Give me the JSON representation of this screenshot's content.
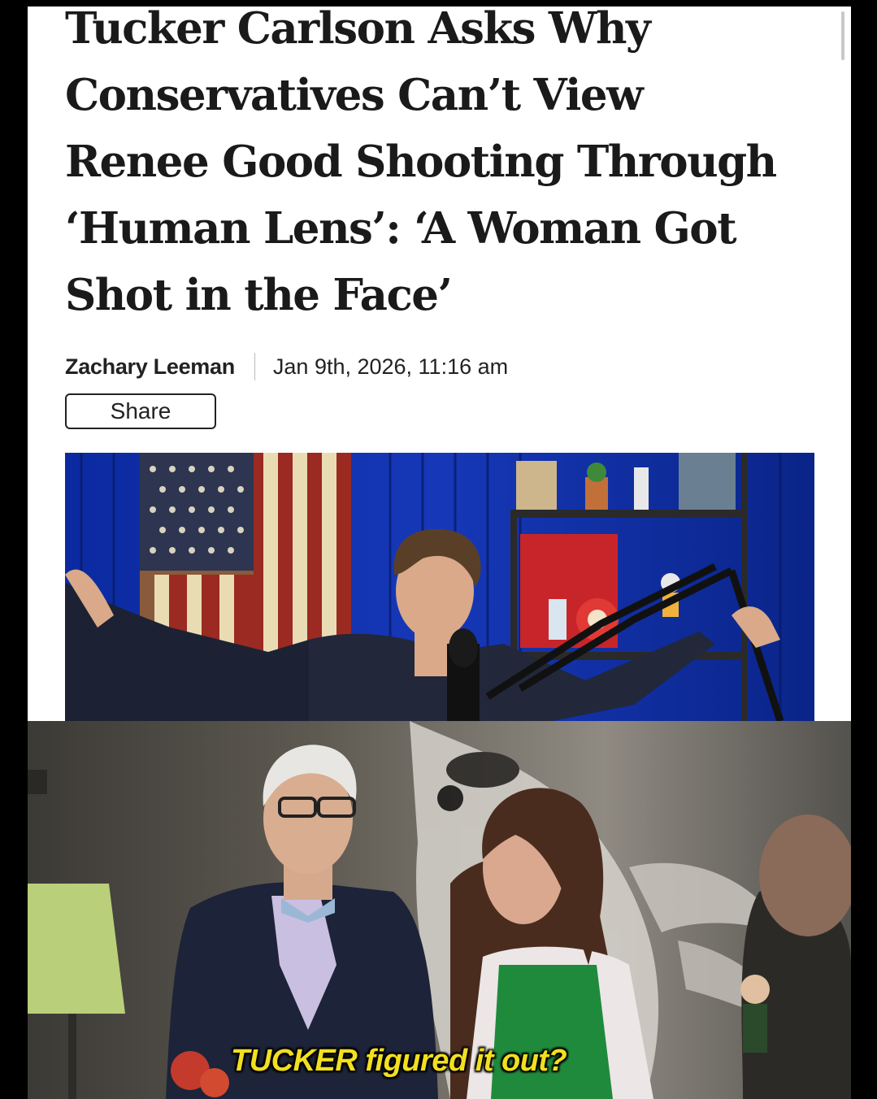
{
  "article": {
    "headline": "Tucker Carlson Asks Why Conservatives Can’t View Renee Good Shooting Through ‘Human Lens’: ‘A Woman Got Shot in the Face’",
    "author": "Zachary Leeman",
    "date": "Jan 9th, 2026, 11:16 am",
    "share_label": "Share"
  },
  "meme": {
    "caption": "TUCKER figured it out?"
  }
}
